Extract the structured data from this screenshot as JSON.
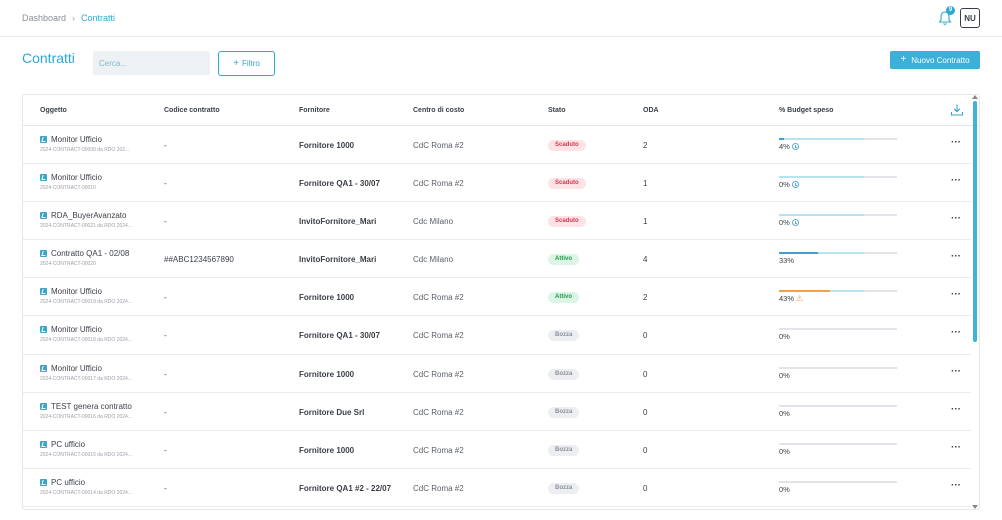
{
  "breadcrumb": {
    "home": "Dashboard",
    "separator": "›",
    "current": "Contratti"
  },
  "header": {
    "notification_count": "9",
    "avatar_initials": "NU"
  },
  "toolbar": {
    "title": "Contratti",
    "search_placeholder": "Cerca...",
    "filter_label": "Filtro",
    "new_label": "Nuovo Contratto"
  },
  "colors": {
    "accent": "#2fa8d2",
    "scaduto": "#d9344f",
    "attivo": "#1f9a4d",
    "bozza": "#8a9099",
    "warning": "#f0a050"
  },
  "table": {
    "columns": [
      "Oggetto",
      "Codice contratto",
      "Fornitore",
      "Centro di costo",
      "Stato",
      "ODA",
      "% Budget speso"
    ],
    "rows": [
      {
        "title": "Monitor Ufficio",
        "sub": "2024-CONTRACT-00008 da RDO 202...",
        "code": "-",
        "supplier": "Fornitore 1000",
        "cdc": "CdC Roma #2",
        "status": "Scaduto",
        "status_kind": "scaduto",
        "oda": "2",
        "budget": "4%",
        "budget_pct": 4,
        "budget_icon": "clock-icon"
      },
      {
        "title": "Monitor Ufficio",
        "sub": "2024-CONTRACT-00010",
        "code": "-",
        "supplier": "Fornitore QA1 - 30/07",
        "cdc": "CdC Roma #2",
        "status": "Scaduto",
        "status_kind": "scaduto",
        "oda": "1",
        "budget": "0%",
        "budget_pct": 0,
        "budget_icon": "clock-icon"
      },
      {
        "title": "RDA_BuyerAvanzato",
        "sub": "2024-CONTRACT-00021 da RDO 2024...",
        "code": "-",
        "supplier": "InvitoFornitore_Mari",
        "cdc": "Cdc Milano",
        "status": "Scaduto",
        "status_kind": "scaduto",
        "oda": "1",
        "budget": "0%",
        "budget_pct": 0,
        "budget_icon": "clock-icon"
      },
      {
        "title": "Contratto QA1 - 02/08",
        "sub": "2024-CONTRACT-00020",
        "code": "##ABC1234567890",
        "supplier": "InvitoFornitore_Mari",
        "cdc": "Cdc Milano",
        "status": "Attivo",
        "status_kind": "attivo",
        "oda": "4",
        "budget": "33%",
        "budget_pct": 33,
        "budget_icon": ""
      },
      {
        "title": "Monitor Ufficio",
        "sub": "2024-CONTRACT-00019 da RDO 2024...",
        "code": "-",
        "supplier": "Fornitore 1000",
        "cdc": "CdC Roma #2",
        "status": "Attivo",
        "status_kind": "attivo",
        "oda": "2",
        "budget": "43%",
        "budget_pct": 43,
        "budget_icon": "warning-icon"
      },
      {
        "title": "Monitor Ufficio",
        "sub": "2024-CONTRACT-00018 da RDO 2024...",
        "code": "-",
        "supplier": "Fornitore QA1 - 30/07",
        "cdc": "CdC Roma #2",
        "status": "Bozza",
        "status_kind": "bozza",
        "oda": "0",
        "budget": "0%",
        "budget_pct": 0,
        "budget_icon": ""
      },
      {
        "title": "Monitor Ufficio",
        "sub": "2024-CONTRACT-00017 da RDO 2024...",
        "code": "-",
        "supplier": "Fornitore 1000",
        "cdc": "CdC Roma #2",
        "status": "Bozza",
        "status_kind": "bozza",
        "oda": "0",
        "budget": "0%",
        "budget_pct": 0,
        "budget_icon": ""
      },
      {
        "title": "TEST genera contratto",
        "sub": "2024-CONTRACT-00016 da RDO 2024...",
        "code": "-",
        "supplier": "Fornitore Due Srl",
        "cdc": "CdC Roma #2",
        "status": "Bozza",
        "status_kind": "bozza",
        "oda": "0",
        "budget": "0%",
        "budget_pct": 0,
        "budget_icon": ""
      },
      {
        "title": "PC ufficio",
        "sub": "2024-CONTRACT-00015 da RDO 2024...",
        "code": "-",
        "supplier": "Fornitore 1000",
        "cdc": "CdC Roma #2",
        "status": "Bozza",
        "status_kind": "bozza",
        "oda": "0",
        "budget": "0%",
        "budget_pct": 0,
        "budget_icon": ""
      },
      {
        "title": "PC ufficio",
        "sub": "2024-CONTRACT-00014 da RDO 2024...",
        "code": "-",
        "supplier": "Fornitore QA1 #2 - 22/07",
        "cdc": "CdC Roma #2",
        "status": "Bozza",
        "status_kind": "bozza",
        "oda": "0",
        "budget": "0%",
        "budget_pct": 0,
        "budget_icon": ""
      }
    ]
  }
}
